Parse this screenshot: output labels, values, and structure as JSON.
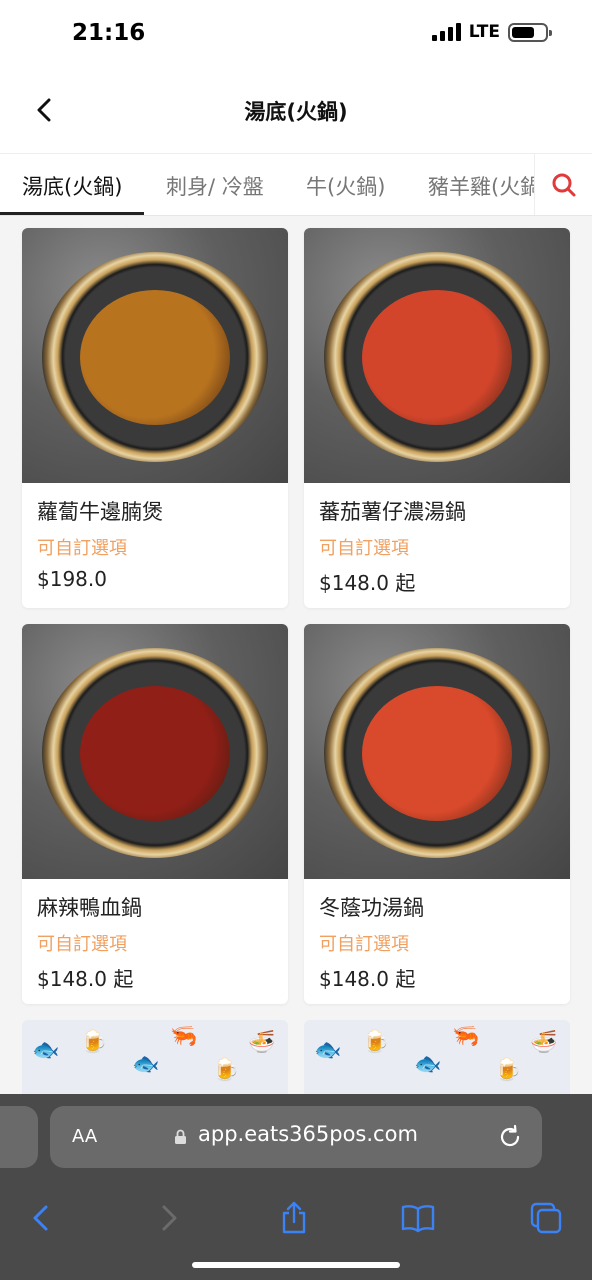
{
  "status_bar": {
    "time": "21:16",
    "network": "LTE"
  },
  "header": {
    "title": "湯底(火鍋)"
  },
  "tabs": [
    {
      "label": "湯底(火鍋)",
      "active": true
    },
    {
      "label": "刺身/ 冷盤",
      "active": false
    },
    {
      "label": "牛(火鍋)",
      "active": false
    },
    {
      "label": "豬羊雞(火鍋",
      "active": false
    }
  ],
  "products": [
    {
      "name": "蘿蔔牛邊腩煲",
      "option": "可自訂選項",
      "price": "$198.0",
      "soup_color": "#b8731f"
    },
    {
      "name": "蕃茄薯仔濃湯鍋",
      "option": "可自訂選項",
      "price": "$148.0 起",
      "soup_color": "#d2452b"
    },
    {
      "name": "麻辣鴨血鍋",
      "option": "可自訂選項",
      "price": "$148.0 起",
      "soup_color": "#8f1f17"
    },
    {
      "name": "冬蔭功湯鍋",
      "option": "可自訂選項",
      "price": "$148.0 起",
      "soup_color": "#d9492b"
    }
  ],
  "browser": {
    "aa_label": "AA",
    "url": "app.eats365pos.com"
  },
  "colors": {
    "accent": "#e03a3a",
    "option_text": "#f0a060",
    "ios_blue": "#3b82f6"
  }
}
